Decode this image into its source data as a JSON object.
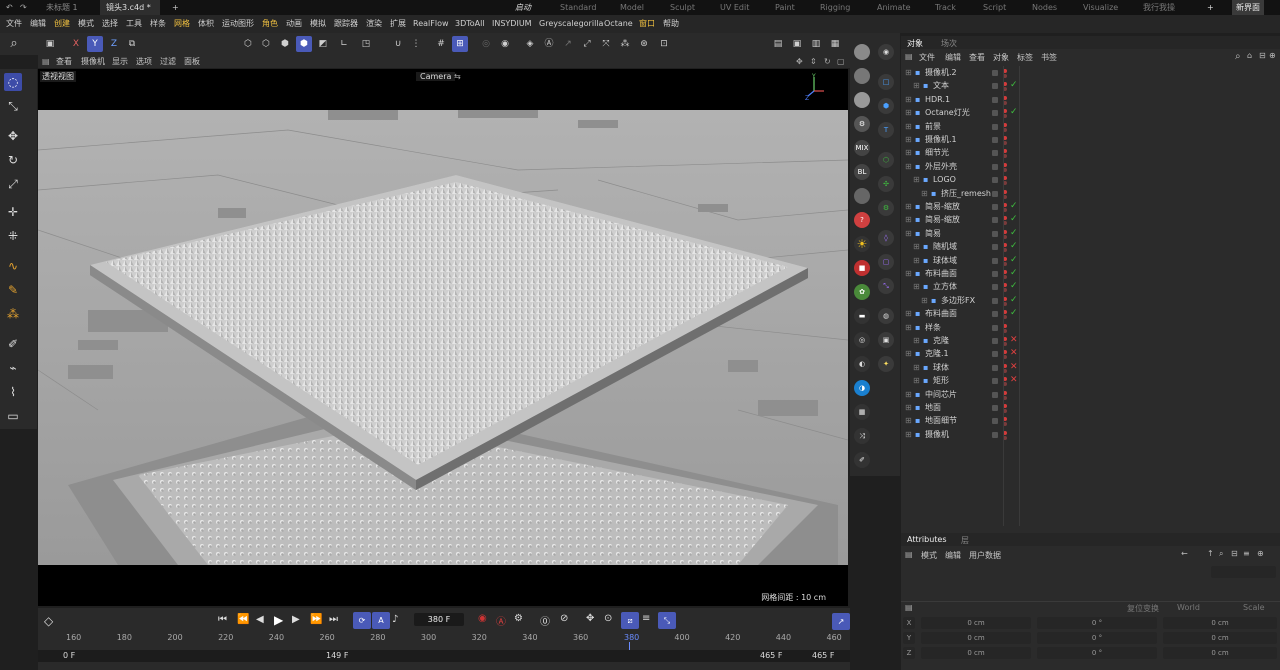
{
  "tabs": {
    "untitled": "未标题 1",
    "active_file": "镜头3.c4d *",
    "add": "+",
    "layouts": [
      "启动",
      "Standard",
      "Model",
      "Sculpt",
      "UV Edit",
      "Paint",
      "Rigging",
      "Animate",
      "Track",
      "Script",
      "Nodes",
      "Visualize"
    ],
    "custom_layout": "我行我操",
    "new_ui": "新界面"
  },
  "menu": [
    "文件",
    "编辑",
    "创建",
    "模式",
    "选择",
    "工具",
    "样条",
    "网格",
    "体积",
    "运动图形",
    "角色",
    "动画",
    "模拟",
    "跟踪器",
    "渲染",
    "扩展",
    "RealFlow",
    "3DToAll",
    "INSYDIUM",
    "Greyscalegorilla",
    "Octane",
    "窗口",
    "帮助"
  ],
  "axis_toggles": {
    "x": "X",
    "y": "Y",
    "z": "Z"
  },
  "viewport": {
    "menu": [
      "查看",
      "摄像机",
      "显示",
      "选项",
      "过滤",
      "面板"
    ],
    "label": "透视视图",
    "camera": "Camera",
    "grid_info": "网格间距 : 10 cm"
  },
  "object_manager": {
    "tabs": [
      "对象",
      "场次"
    ],
    "menu": [
      "文件",
      "编辑",
      "查看",
      "对象",
      "标签",
      "书签"
    ],
    "rows": [
      {
        "label": "摄像机.2",
        "indent": 0,
        "state": "dot"
      },
      {
        "label": "文本",
        "indent": 1,
        "state": "check"
      },
      {
        "label": "HDR.1",
        "indent": 0,
        "state": "dot"
      },
      {
        "label": "Octane灯光",
        "indent": 0,
        "state": "check"
      },
      {
        "label": "前景",
        "indent": 0,
        "state": "dot"
      },
      {
        "label": "摄像机.1",
        "indent": 0,
        "state": "dot"
      },
      {
        "label": "细节光",
        "indent": 0,
        "state": "dot"
      },
      {
        "label": "外层外壳",
        "indent": 0,
        "state": "dot"
      },
      {
        "label": "LOGO",
        "indent": 1,
        "state": "dot"
      },
      {
        "label": "挤压_remesh",
        "indent": 2,
        "state": "dot"
      },
      {
        "label": "简易-缩放",
        "indent": 0,
        "state": "check"
      },
      {
        "label": "简易-缩放",
        "indent": 0,
        "state": "check"
      },
      {
        "label": "简易",
        "indent": 0,
        "state": "check"
      },
      {
        "label": "随机域",
        "indent": 1,
        "state": "check"
      },
      {
        "label": "球体域",
        "indent": 1,
        "state": "check"
      },
      {
        "label": "布料曲面",
        "indent": 0,
        "state": "check"
      },
      {
        "label": "立方体",
        "indent": 1,
        "state": "check"
      },
      {
        "label": "多边形FX",
        "indent": 2,
        "state": "check"
      },
      {
        "label": "布料曲面",
        "indent": 0,
        "state": "check"
      },
      {
        "label": "样条",
        "indent": 0,
        "state": "dot"
      },
      {
        "label": "克隆",
        "indent": 1,
        "state": "cross"
      },
      {
        "label": "克隆.1",
        "indent": 0,
        "state": "cross"
      },
      {
        "label": "球体",
        "indent": 1,
        "state": "cross"
      },
      {
        "label": "矩形",
        "indent": 1,
        "state": "cross"
      },
      {
        "label": "中间芯片",
        "indent": 0,
        "state": "dot"
      },
      {
        "label": "地面",
        "indent": 0,
        "state": "dot"
      },
      {
        "label": "地面细节",
        "indent": 0,
        "state": "dot"
      },
      {
        "label": "摄像机",
        "indent": 0,
        "state": "dot"
      }
    ]
  },
  "attributes": {
    "tabs": [
      "Attributes",
      "层"
    ],
    "menu": [
      "模式",
      "编辑",
      "用户数据"
    ],
    "reset": "复位变换",
    "space": "World",
    "scale": "Scale",
    "coords": [
      {
        "axis": "X",
        "pos": "0 cm",
        "rot": "0 °",
        "size": "0 cm"
      },
      {
        "axis": "Y",
        "pos": "0 cm",
        "rot": "0 °",
        "size": "0 cm"
      },
      {
        "axis": "Z",
        "pos": "0 cm",
        "rot": "0 °",
        "size": "0 cm"
      }
    ]
  },
  "timeline": {
    "current_frame": "380 F",
    "ticks": [
      "160",
      "180",
      "200",
      "220",
      "240",
      "260",
      "280",
      "300",
      "320",
      "340",
      "360",
      "380",
      "400",
      "420",
      "440",
      "460"
    ],
    "start": "0 F",
    "preview_start": "149 F",
    "preview_end": "465 F",
    "end": "465 F",
    "playhead_label": "380"
  },
  "colors": {
    "accent": "#4a5ab8",
    "active_green": "#3fbf3f",
    "red": "#d43b3b",
    "bg": "#2b2b2b"
  }
}
